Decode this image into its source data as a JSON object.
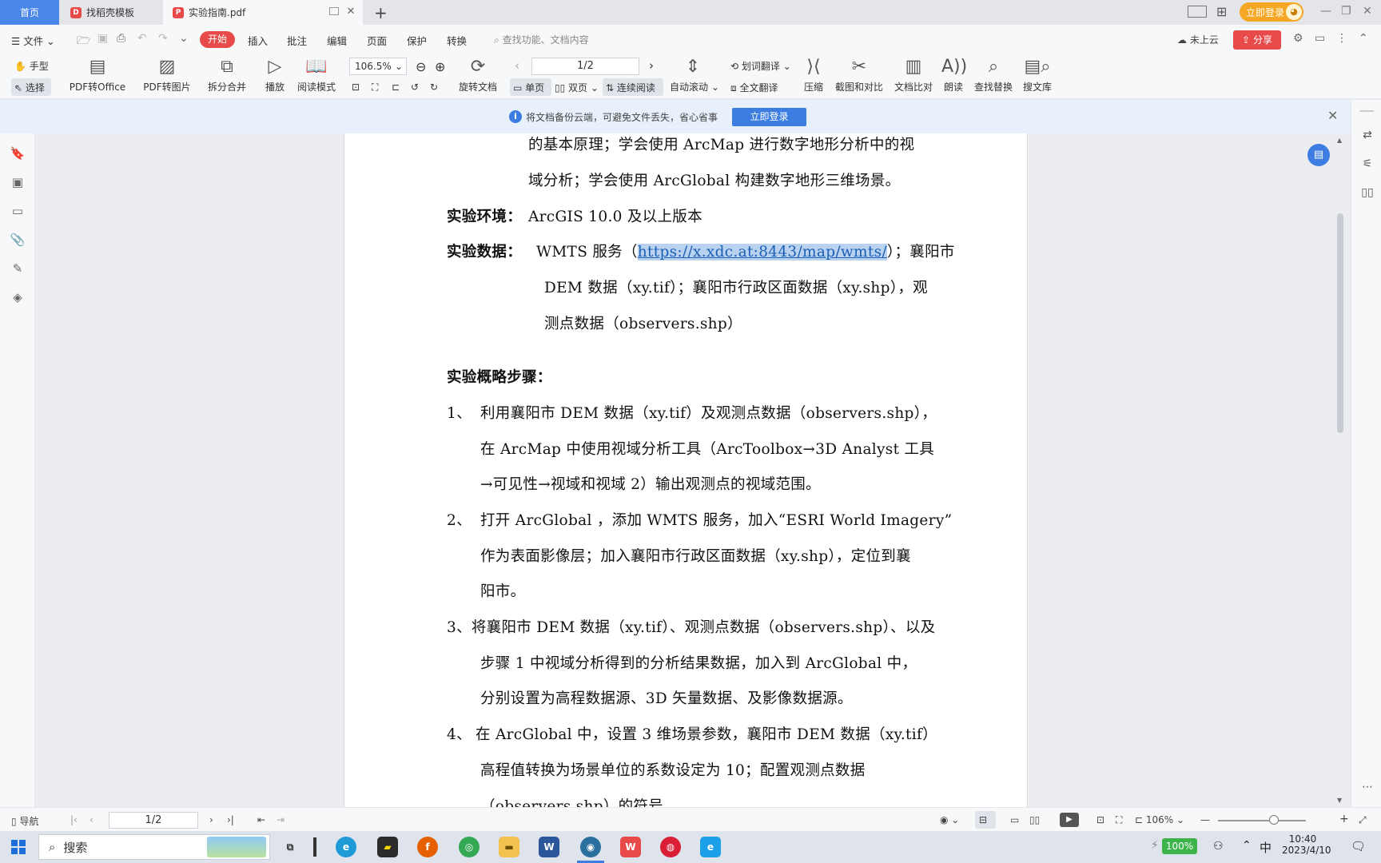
{
  "tabs": {
    "home": "首页",
    "template": "找稻壳模板",
    "document": "实验指南.pdf",
    "login": "立即登录"
  },
  "menu": {
    "file": "文件",
    "items": [
      "开始",
      "插入",
      "批注",
      "编辑",
      "页面",
      "保护",
      "转换"
    ],
    "search_placeholder": "查找功能、文档内容",
    "cloud_status": "未上云",
    "share": "分享"
  },
  "ribbon": {
    "hand": "手型",
    "select": "选择",
    "pdf_to_office": "PDF转Office",
    "pdf_to_image": "PDF转图片",
    "split_merge": "拆分合并",
    "play": "播放",
    "read_mode": "阅读模式",
    "zoom": "106.5%",
    "page": "1/2",
    "rotate": "旋转文档",
    "single": "单页",
    "double": "双页",
    "continuous": "连续阅读",
    "auto_scroll": "自动滚动",
    "word_translate": "划词翻译",
    "full_translate": "全文翻译",
    "compress": "压缩",
    "screenshot_compare": "截图和对比",
    "doc_compare": "文档比对",
    "read_aloud": "朗读",
    "find_replace": "查找替换",
    "search_library": "搜文库"
  },
  "notify": {
    "text": "将文档备份云端，可避免文件丢失，省心省事",
    "button": "立即登录"
  },
  "document": {
    "l1": "的基本原理；学会使用 ArcMap 进行数字地形分析中的视",
    "l2": "域分析；学会使用 ArcGlobal 构建数字地形三维场景。",
    "env_label": "实验环境：",
    "env_value": "ArcGIS 10.0 及以上版本",
    "data_label": "实验数据：",
    "data_pre": "WMTS 服务（",
    "data_link": "https://x.xdc.at:8443/map/wmts/",
    "data_post": "）；襄阳市",
    "data_l2": "DEM 数据（xy.tif）；襄阳市行政区面数据（xy.shp），观",
    "data_l3": "测点数据（observers.shp）",
    "steps_title": "实验概略步骤：",
    "s1_num": "1、",
    "s1_l1": "利用襄阳市 DEM 数据（xy.tif）及观测点数据（observers.shp），",
    "s1_l2": "在 ArcMap 中使用视域分析工具（ArcToolbox→3D Analyst 工具",
    "s1_l3": "→可见性→视域和视域 2）输出观测点的视域范围。",
    "s2_num": "2、",
    "s2_l1": "打开 ArcGlobal ，添加 WMTS 服务，加入“ESRI World Imagery”",
    "s2_l2": "作为表面影像层；加入襄阳市行政区面数据（xy.shp），定位到襄",
    "s2_l3": "阳市。",
    "s3_l1": "3、将襄阳市 DEM 数据（xy.tif）、观测点数据（observers.shp）、以及",
    "s3_l2": "步骤 1 中视域分析得到的分析结果数据，加入到 ArcGlobal 中，",
    "s3_l3": "分别设置为高程数据源、3D 矢量数据、及影像数据源。",
    "s4_num": "4、",
    "s4_l1": "在 ArcGlobal 中，设置 3 维场景参数，襄阳市 DEM 数据（xy.tif）",
    "s4_l2": "高程值转换为场景单位的系数设定为 10；配置观测点数据",
    "s4_l3": "（observers.shp）的符号"
  },
  "status": {
    "nav": "导航",
    "page": "1/2",
    "zoom": "106%"
  },
  "taskbar": {
    "search": "搜索",
    "battery": "100%",
    "ime": "中",
    "time": "10:40",
    "date": "2023/4/10"
  },
  "colors": {
    "accent_blue": "#3d7ce0",
    "start_red": "#e84a4a",
    "login_orange": "#f5a623"
  }
}
